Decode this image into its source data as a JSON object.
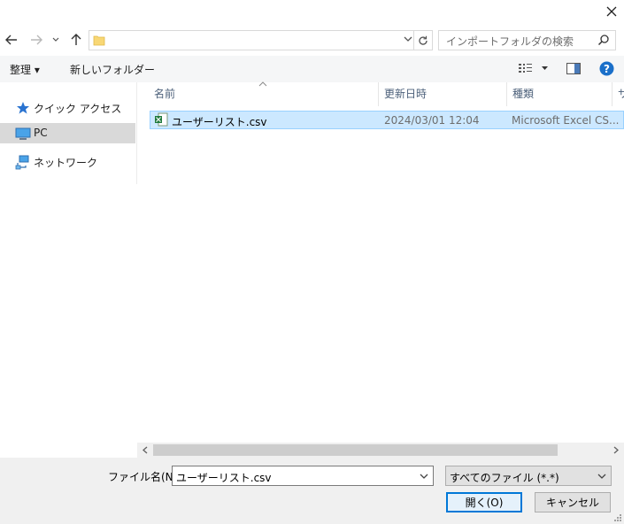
{
  "address": {
    "value": ""
  },
  "search": {
    "placeholder": "インポートフォルダの検索"
  },
  "toolbar": {
    "organize": "整理 ▾",
    "new_folder": "新しいフォルダー"
  },
  "sidebar": {
    "items": [
      {
        "label": "クイック アクセス",
        "icon": "star-icon"
      },
      {
        "label": "PC",
        "icon": "computer-icon",
        "selected": true
      },
      {
        "label": "ネットワーク",
        "icon": "network-icon"
      }
    ]
  },
  "columns": {
    "name": "名前",
    "date": "更新日時",
    "type": "種類",
    "size": "サ"
  },
  "files": [
    {
      "name": "ユーザーリスト.csv",
      "date": "2024/03/01 12:04",
      "type": "Microsoft Excel CS...",
      "icon": "excel-csv-icon",
      "selected": true
    }
  ],
  "footer": {
    "filename_label": "ファイル名(N):",
    "filename_value": "ユーザーリスト.csv",
    "filetype": "すべてのファイル (*.*)",
    "open_label": "開く(O)",
    "cancel_label": "キャンセル"
  },
  "colors": {
    "accent": "#0078d7",
    "selection": "#cce8ff",
    "help": "#1a6fc9"
  }
}
